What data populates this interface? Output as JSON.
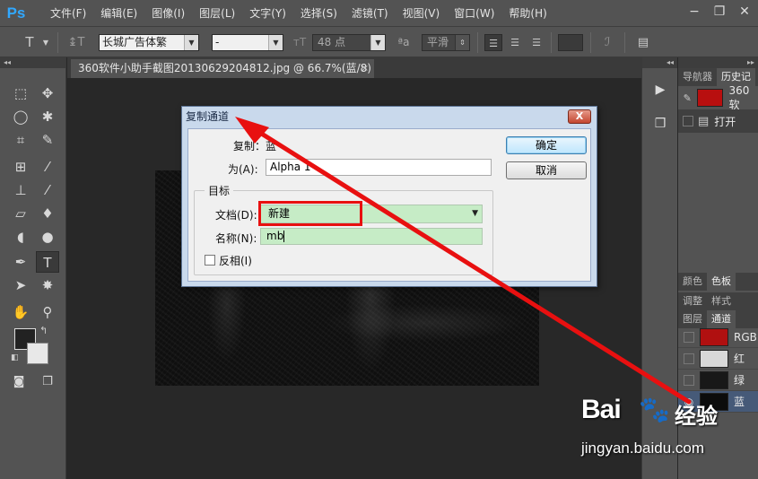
{
  "app": {
    "logo": "Ps"
  },
  "menu": [
    "文件(F)",
    "编辑(E)",
    "图像(I)",
    "图层(L)",
    "文字(Y)",
    "选择(S)",
    "滤镜(T)",
    "视图(V)",
    "窗口(W)",
    "帮助(H)"
  ],
  "window_controls": {
    "minimize": "−",
    "restore": "❐",
    "close": "✕"
  },
  "options_bar": {
    "tool_glyph": "T",
    "font_family": "长城广告体繁",
    "font_style": "-",
    "font_size": "48 点",
    "aa_icon": "ªa",
    "antialias": "平滑"
  },
  "document": {
    "tab_title": "360软件小助手截图20130629204812.jpg @ 66.7%(蓝/8)",
    "tab_close": "×"
  },
  "panels": {
    "top_tabs": [
      "导航器",
      "历史记"
    ],
    "history": [
      {
        "label": "360软",
        "thumb_color": "#b80f0f"
      },
      {
        "label": "打开",
        "thumb_color": ""
      }
    ],
    "color_tabs": [
      "颜色",
      "色板"
    ],
    "adjust_tabs": [
      "调整",
      "样式"
    ],
    "layer_tabs": [
      "图层",
      "通道"
    ],
    "channels": [
      {
        "label": "RGB",
        "thumb_color": "#b01010"
      },
      {
        "label": "红",
        "thumb_color": "#d8d8d8"
      },
      {
        "label": "绿",
        "thumb_color": "#181818"
      },
      {
        "label": "蓝",
        "thumb_color": "#0c0c0c"
      }
    ]
  },
  "dialog": {
    "title": "复制通道",
    "close_label": "X",
    "duplicate_label": "复制：",
    "duplicate_value": "蓝",
    "as_label": "为(A):",
    "as_value": "Alpha 1",
    "target_group": "目标",
    "document_label": "文档(D):",
    "document_value": "新建",
    "name_label": "名称(N):",
    "name_value": "mb",
    "invert_label": "反相(I)",
    "ok_label": "确定",
    "cancel_label": "取消"
  },
  "annotation": {
    "highlight_color": "#e81010",
    "arrow_color": "#e81010"
  },
  "watermark": {
    "logo": "Bai",
    "paw": "🐾",
    "text": "经验",
    "url": "jingyan.baidu.com"
  }
}
